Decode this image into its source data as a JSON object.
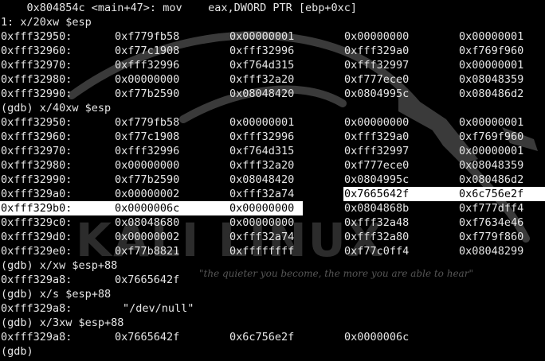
{
  "header_line": "    0x804854c <main+47>: mov    eax,DWORD PTR [ebp+0xc]",
  "display_line": "1: x/20xw $esp",
  "display_rows": [
    [
      "0xfff32950:",
      "0xf779fb58",
      "0x00000001",
      "0x00000000",
      "0x00000001"
    ],
    [
      "0xfff32960:",
      "0xf77c1908",
      "0xfff32996",
      "0xfff329a0",
      "0xf769f960"
    ],
    [
      "0xfff32970:",
      "0xfff32996",
      "0xf764d315",
      "0xfff32997",
      "0x00000001"
    ],
    [
      "0xfff32980:",
      "0x00000000",
      "0xfff32a20",
      "0xf777ece0",
      "0x08048359"
    ],
    [
      "0xfff32990:",
      "0xf77b2590",
      "0x08048420",
      "0x0804995c",
      "0x080486d2"
    ]
  ],
  "cmd_x40": "(gdb) x/40xw $esp",
  "x40_rows": [
    [
      "0xfff32950:",
      "0xf779fb58",
      "0x00000001",
      "0x00000000",
      "0x00000001"
    ],
    [
      "0xfff32960:",
      "0xf77c1908",
      "0xfff32996",
      "0xfff329a0",
      "0xf769f960"
    ],
    [
      "0xfff32970:",
      "0xfff32996",
      "0xf764d315",
      "0xfff32997",
      "0x00000001"
    ],
    [
      "0xfff32980:",
      "0x00000000",
      "0xfff32a20",
      "0xf777ece0",
      "0x08048359"
    ],
    [
      "0xfff32990:",
      "0xf77b2590",
      "0x08048420",
      "0x0804995c",
      "0x080486d2"
    ],
    [
      "0xfff329a0:",
      "0x00000002",
      "0xfff32a74",
      "0x7665642f",
      "0x6c756e2f"
    ],
    [
      "0xfff329b0:",
      "0x0000006c",
      "0x00000000",
      "0x0804868b",
      "0xf777dff4"
    ],
    [
      "0xfff329c0:",
      "0x08048680",
      "0x00000000",
      "0xfff32a48",
      "0xf7634e46"
    ],
    [
      "0xfff329d0:",
      "0x00000002",
      "0xfff32a74",
      "0xfff32a80",
      "0xf779f860"
    ],
    [
      "0xfff329e0:",
      "0xf77b8821",
      "0xffffffff",
      "0xf77c0ff4",
      "0x08048299"
    ]
  ],
  "cmd_xw": "(gdb) x/xw $esp+88",
  "xw_row": [
    "0xfff329a8:",
    "0x7665642f"
  ],
  "cmd_xs": "(gdb) x/s $esp+88",
  "xs_row": [
    "0xfff329a8:",
    "\"/dev/null\""
  ],
  "cmd_x3": "(gdb) x/3xw $esp+88",
  "x3_row": [
    "0xfff329a8:",
    "0x7665642f",
    "0x6c756e2f",
    "0x0000006c"
  ],
  "final_prompt": "(gdb) ",
  "wallpaper": {
    "logo_text": "KALI LINUX",
    "tagline": "\"the quieter you become, the more you are able to hear\"",
    "color": "#4a4a4a"
  },
  "colors": {
    "background": "#000000",
    "text": "#e6e6e6",
    "highlight_bg": "#ffffff",
    "highlight_text": "#000000"
  }
}
